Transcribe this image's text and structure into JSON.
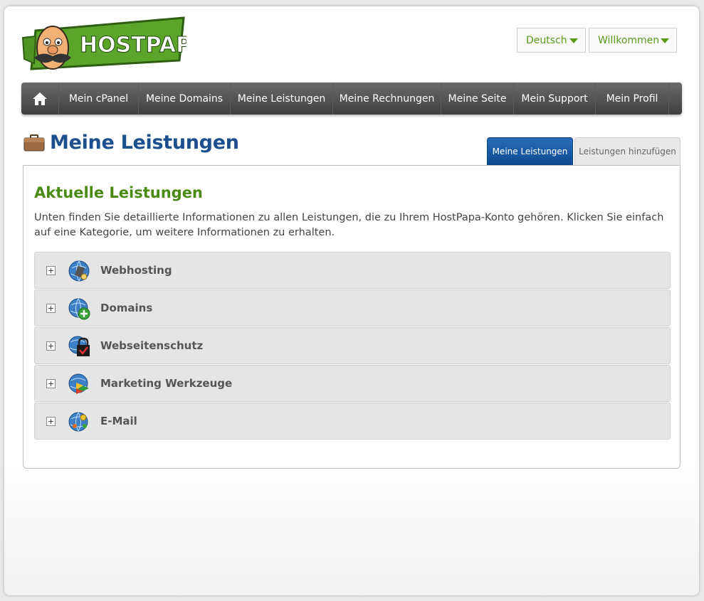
{
  "brand": {
    "logo_text": "HOSTPAPA",
    "green": "#3f8f1a",
    "blue": "#1c4f8e"
  },
  "header": {
    "language": "Deutsch",
    "user_menu": "Willkommen"
  },
  "nav": {
    "home_icon": "home-icon",
    "items": [
      "Mein cPanel",
      "Meine Domains",
      "Meine Leistungen",
      "Meine Rechnungen",
      "Meine Seite",
      "Mein Support",
      "Mein Profil"
    ]
  },
  "page": {
    "title": "Meine Leistungen",
    "title_icon": "briefcase-icon",
    "tabs": [
      "Meine Leistungen",
      "Leistungen hinzufügen"
    ]
  },
  "main": {
    "section_title": "Aktuelle Leistungen",
    "intro": "Unten finden Sie detaillierte Informationen zu allen Leistungen, die zu Ihrem HostPapa-Konto gehören. Klicken Sie einfach auf eine Kategorie, um weitere Informationen zu erhalten.",
    "categories": [
      {
        "label": "Webhosting",
        "icon": "webhosting-globe-icon",
        "expander": "+"
      },
      {
        "label": "Domains",
        "icon": "domains-globe-plus-icon",
        "expander": "+"
      },
      {
        "label": "Webseitenschutz",
        "icon": "website-protection-lock-icon",
        "expander": "+"
      },
      {
        "label": "Marketing Werkzeuge",
        "icon": "marketing-globe-icon",
        "expander": "+"
      },
      {
        "label": "E-Mail",
        "icon": "email-globe-icon",
        "expander": "+"
      }
    ]
  }
}
